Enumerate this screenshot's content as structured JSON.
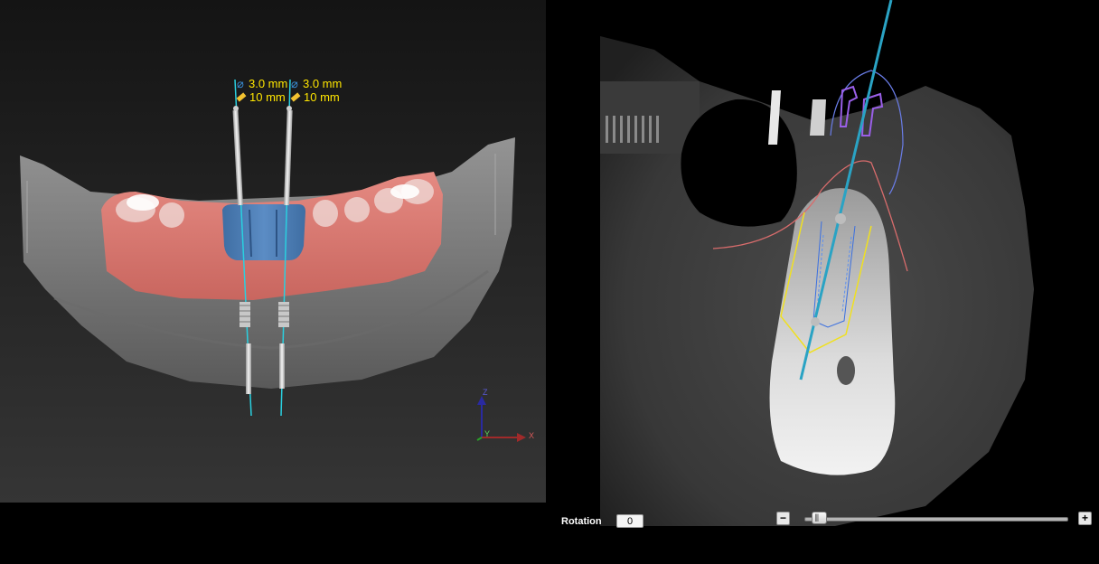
{
  "viewport3d": {
    "implants": [
      {
        "diameter": "3.0 mm",
        "length": "10 mm"
      },
      {
        "diameter": "3.0 mm",
        "length": "10 mm"
      }
    ],
    "axes": {
      "z": "Z",
      "y": "Y",
      "x": "X"
    },
    "colors": {
      "gingiva": "#d9756e",
      "crown": "#4f7fb5",
      "bone": "#8d8d8d",
      "label": "#ffe600"
    }
  },
  "controls": {
    "rotation_label": "Rotation",
    "rotation_value": "0",
    "zoom_minus": "−",
    "zoom_plus": "+",
    "zoom_level": 0.03
  },
  "ct": {
    "colors": {
      "trajectory": "#2aa3c4",
      "safety_zone": "#f0e020",
      "nerve_outline": "#d86c6c",
      "implant_outline": "#3a6fe0",
      "tooth_outline": "#8c5fd8"
    }
  }
}
